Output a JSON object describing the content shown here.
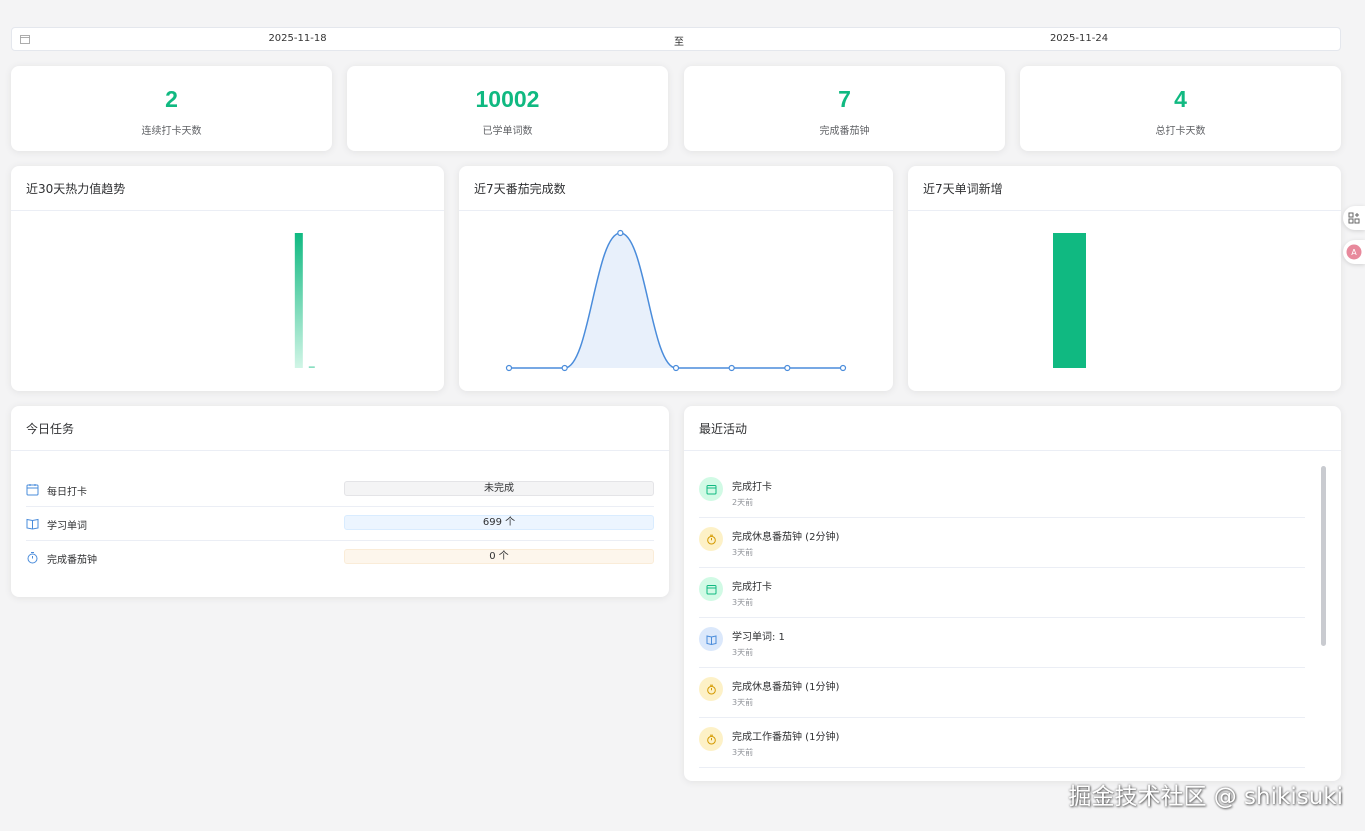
{
  "date_range": {
    "start": "2025-11-18",
    "separator": "至",
    "end": "2025-11-24"
  },
  "stats": [
    {
      "value": "2",
      "label": "连续打卡天数"
    },
    {
      "value": "10002",
      "label": "已学单词数"
    },
    {
      "value": "7",
      "label": "完成番茄钟"
    },
    {
      "value": "4",
      "label": "总打卡天数"
    }
  ],
  "colors": {
    "accent": "#10b981",
    "line": "#4a8cdb",
    "area_fill": "#e8f0fb"
  },
  "charts": {
    "heat_title": "近30天热力值趋势",
    "tomato_title": "近7天番茄完成数",
    "words_title": "近7天单词新增"
  },
  "chart_data": [
    {
      "type": "bar",
      "title": "近30天热力值趋势",
      "series": [
        {
          "values": [
            0,
            0,
            0,
            0,
            0,
            0,
            0,
            0,
            0,
            0,
            0,
            0,
            0,
            0,
            0,
            0,
            0,
            0,
            0,
            0,
            100,
            1,
            0,
            0,
            0,
            0,
            0,
            0,
            0,
            0
          ]
        }
      ]
    },
    {
      "type": "line",
      "title": "近7天番茄完成数",
      "smooth": true,
      "area": true,
      "series": [
        {
          "values": [
            0,
            0,
            7,
            0,
            0,
            0,
            0
          ]
        }
      ]
    },
    {
      "type": "bar",
      "title": "近7天单词新增",
      "series": [
        {
          "values": [
            1
          ]
        }
      ]
    }
  ],
  "tasks": {
    "title": "今日任务",
    "items": [
      {
        "icon": "calendar-icon",
        "name": "每日打卡",
        "status": "未完成",
        "tag_bg": "#f4f4f5",
        "tag_border": "#e4e4e7",
        "tag_color": "#303133"
      },
      {
        "icon": "book-icon",
        "name": "学习单词",
        "status": "699 个",
        "tag_bg": "#ecf5ff",
        "tag_border": "#d9ecff",
        "tag_color": "#303133"
      },
      {
        "icon": "timer-icon",
        "name": "完成番茄钟",
        "status": "0 个",
        "tag_bg": "#fdf6ec",
        "tag_border": "#faecd8",
        "tag_color": "#303133"
      }
    ]
  },
  "activity": {
    "title": "最近活动",
    "items": [
      {
        "type": "checkin",
        "icon": "calendar-icon",
        "title": "完成打卡",
        "time": "2天前"
      },
      {
        "type": "pomodoro",
        "icon": "timer-icon",
        "title": "完成休息番茄钟 (2分钟)",
        "time": "3天前"
      },
      {
        "type": "checkin",
        "icon": "calendar-icon",
        "title": "完成打卡",
        "time": "3天前"
      },
      {
        "type": "words",
        "icon": "book-icon",
        "title": "学习单词: 1",
        "time": "3天前"
      },
      {
        "type": "pomodoro",
        "icon": "timer-icon",
        "title": "完成休息番茄钟 (1分钟)",
        "time": "3天前"
      },
      {
        "type": "pomodoro",
        "icon": "timer-icon",
        "title": "完成工作番茄钟 (1分钟)",
        "time": "3天前"
      }
    ]
  },
  "watermark": "掘金技术社区 @ shikisuki"
}
